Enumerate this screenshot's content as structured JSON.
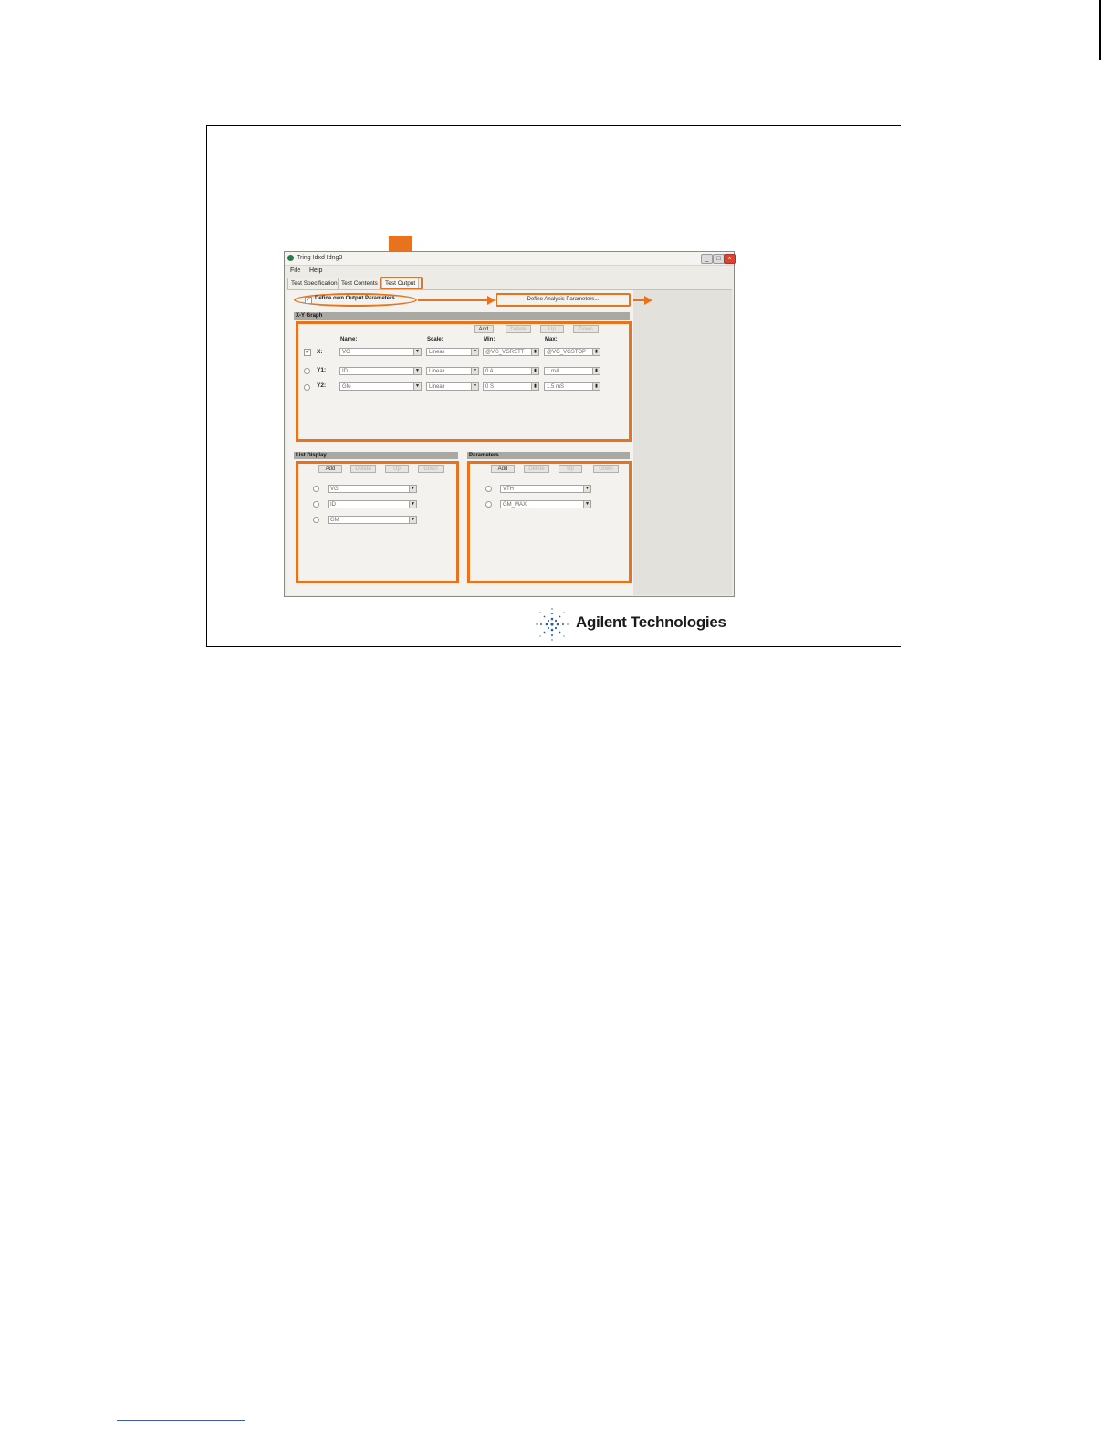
{
  "window": {
    "title": "Tring Idxd Idng3",
    "controls": [
      "_",
      "□",
      "×"
    ]
  },
  "menu": [
    "File",
    "Help"
  ],
  "tabs": [
    {
      "label": "Test Specification",
      "active": false
    },
    {
      "label": "Test Contents",
      "active": false
    },
    {
      "label": "Test Output",
      "active": true
    }
  ],
  "output_option": {
    "label": "Define own Output Parameters",
    "checked": true,
    "define_button": "Define Analysis Parameters..."
  },
  "xy_graph": {
    "title": "X-Y Graph",
    "buttons": [
      {
        "label": "Add",
        "enabled": true
      },
      {
        "label": "Delete",
        "enabled": false
      },
      {
        "label": "Up",
        "enabled": false
      },
      {
        "label": "Down",
        "enabled": false
      }
    ],
    "headers": {
      "name": "Name:",
      "scale": "Scale:",
      "min": "Min:",
      "max": "Max:"
    },
    "rows": [
      {
        "axis": "X:",
        "name": "VG",
        "scale": "Linear",
        "min": "@VG_VGRSTT",
        "max": "@VG_VGSTOP"
      },
      {
        "axis": "Y1:",
        "name": "ID",
        "scale": "Linear",
        "min": "0 A",
        "max": "1 mA"
      },
      {
        "axis": "Y2:",
        "name": "GM",
        "scale": "Linear",
        "min": "0 S",
        "max": "1.5 mS"
      }
    ]
  },
  "list_display": {
    "title": "List Display",
    "buttons": [
      {
        "label": "Add",
        "enabled": true
      },
      {
        "label": "Delete",
        "enabled": false
      },
      {
        "label": "Up",
        "enabled": false
      },
      {
        "label": "Down",
        "enabled": false
      }
    ],
    "items": [
      "VG",
      "ID",
      "GM"
    ]
  },
  "parameters": {
    "title": "Parameters",
    "buttons": [
      {
        "label": "Add",
        "enabled": true
      },
      {
        "label": "Delete",
        "enabled": false
      },
      {
        "label": "Up",
        "enabled": false
      },
      {
        "label": "Down",
        "enabled": false
      }
    ],
    "items": [
      "VTH",
      "GM_MAX"
    ]
  },
  "brand": {
    "name": "Agilent Technologies"
  },
  "colors": {
    "highlight": "#e8731f",
    "brand_blue": "#2a5caa"
  }
}
